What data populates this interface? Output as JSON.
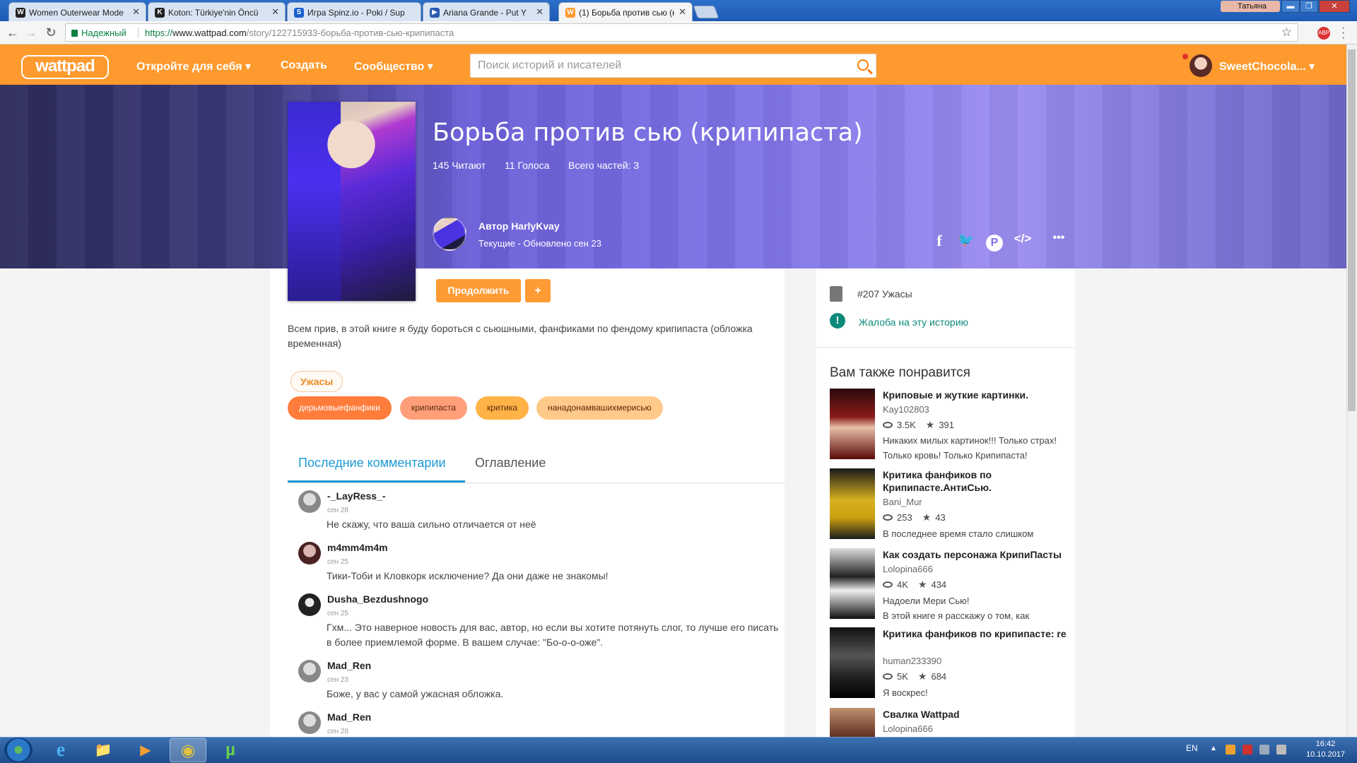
{
  "browser": {
    "tabs": [
      {
        "label": "Women Outerwear Mode",
        "fav": "W"
      },
      {
        "label": "Koton: Türkiye'nin Öncü",
        "fav": "K"
      },
      {
        "label": "Игра Spinz.io - Poki / Sup",
        "fav": "S"
      },
      {
        "label": "Ariana Grande - Put Y",
        "fav": "▶"
      },
      {
        "label": "(1) Борьба против сью (к",
        "fav": "W"
      }
    ],
    "tab_close": "✕",
    "profile_name": "Татьяна",
    "secure_label": "Надежный",
    "url_scheme": "https://",
    "url_host": "www.wattpad.com",
    "url_path": "/story/122715933-борьба-против-сью-крипипаста",
    "star": "☆",
    "ext_label": "ABP"
  },
  "header": {
    "logo": "wattpad",
    "nav": [
      "Откройте для себя ▾",
      "Создать",
      "Сообщество ▾"
    ],
    "search_placeholder": "Поиск историй и писателей",
    "username": "SweetChocola... ▾"
  },
  "story": {
    "title": "Борьба против сью (крипипаста)",
    "reads": "145 Читают",
    "votes": "11 Голоса",
    "parts": "Всего частей: 3",
    "author": "Автор HarlyKvay",
    "status": "Текущие - Обновлено сен 23",
    "continue": "Продолжить",
    "add": "+",
    "description": "Всем прив, в этой книге я буду бороться с сьюшными, фанфиками по фендому крипипаста (обложка временная)",
    "genre_tag": "Ужасы",
    "tags": [
      "дерьмовыефанфики",
      "крипипаста",
      "критика",
      "нанадонамвашихмерисью"
    ]
  },
  "share": {
    "facebook": "f",
    "twitter": "🐦",
    "pinterest": "P",
    "embed": "</>",
    "more": "•••"
  },
  "tabs": {
    "comments": "Последние комментарии",
    "toc": "Оглавление"
  },
  "comments": [
    {
      "name": "-_LayRess_-",
      "date": "сен 28",
      "text": "Не скажу, что ваша сильно отличается от неё"
    },
    {
      "name": "m4mm4m4m",
      "date": "сен 25",
      "text": "Тики-Тоби и Кловкорк исключение? Да они даже не знакомы!"
    },
    {
      "name": "Dusha_Bezdushnogo",
      "date": "сен 25",
      "text": "Гхм... Это наверное новость для вас, автор, но если вы хотите потянуть слог, то лучше его писать в более приемлемой форме. В вашем случае: \"Бо-о-о-оже\"."
    },
    {
      "name": "Mad_Ren",
      "date": "сен 23",
      "text": "Боже, у вас у самой ужасная обложка."
    },
    {
      "name": "Mad_Ren",
      "date": "сен 28",
      "text": ""
    }
  ],
  "sidebar": {
    "rank": "#207 Ужасы",
    "report": "Жалоба на эту историю",
    "rec_title": "Вам также понравится",
    "recs": [
      {
        "title": "Криповые и жуткие картинки.",
        "author": "Kay102803",
        "views": "3.5K",
        "stars": "391",
        "desc": "Никаких милых картинок!!! Только страх! Только кровь! Только Крипипаста!"
      },
      {
        "title": "Критика фанфиков по Крипипасте.АнтиСью.",
        "author": "Bani_Mur",
        "views": "253",
        "stars": "43",
        "desc": "В последнее время стало слишком"
      },
      {
        "title": "Как создать персонажа КрипиПасты",
        "author": "Lolopina666",
        "views": "4K",
        "stars": "434",
        "desc": "Надоели Мери Сью!\nВ этой книге я расскажу о том, как"
      },
      {
        "title": "Критика фанфиков по крипипасте: re",
        "author": "human233390",
        "views": "5K",
        "stars": "684",
        "desc": "Я воскрес!"
      },
      {
        "title": "Свалка Wattpad",
        "author": "Lolopina666",
        "views": "",
        "stars": "",
        "desc": ""
      }
    ],
    "star_glyph": "★"
  },
  "taskbar": {
    "lang": "EN",
    "time": "16:42",
    "date": "10.10.2017",
    "apps": [
      "e",
      "📁",
      "▶",
      "◉",
      "µ"
    ]
  },
  "colors": {
    "accent": "#ff9a2e",
    "link": "#1e9ad6",
    "report": "#0c8a7a"
  }
}
